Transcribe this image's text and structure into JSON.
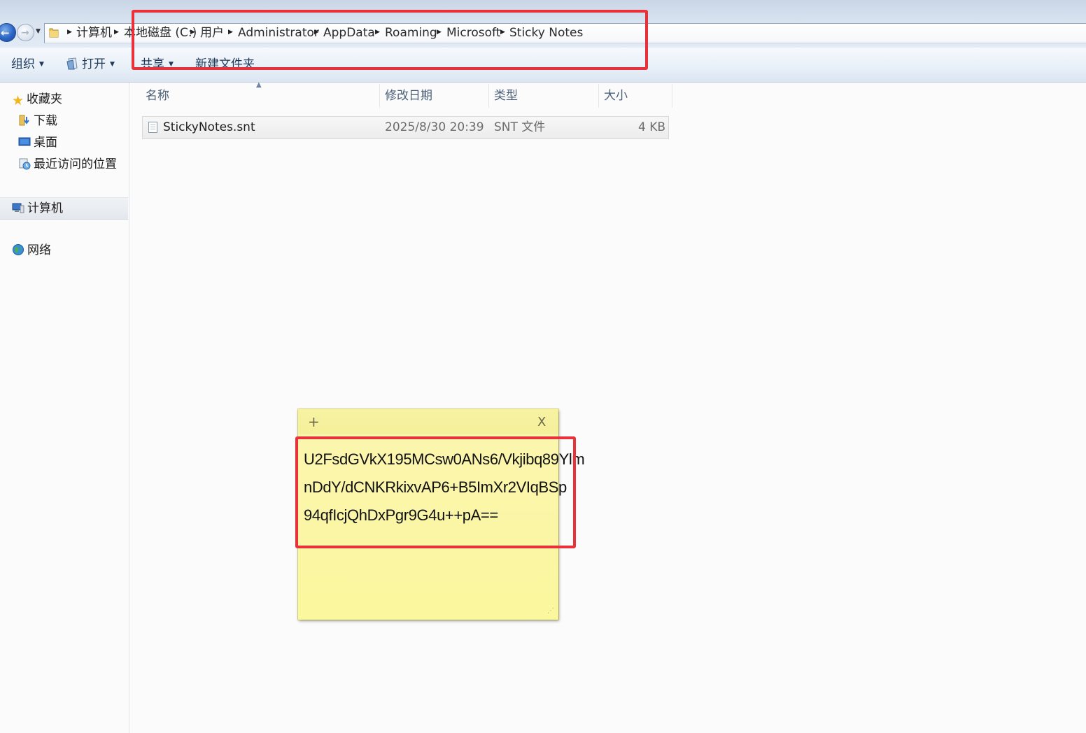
{
  "breadcrumb": [
    "计算机",
    "本地磁盘 (C:)",
    "用户",
    "Administrator",
    "AppData",
    "Roaming",
    "Microsoft",
    "Sticky Notes"
  ],
  "toolbar": {
    "organize": "组织",
    "open": "打开",
    "share": "共享",
    "new_folder": "新建文件夹"
  },
  "sidebar": {
    "favorites": "收藏夹",
    "items": [
      "下载",
      "桌面",
      "最近访问的位置"
    ],
    "computer": "计算机",
    "network": "网络"
  },
  "columns": {
    "name": "名称",
    "modified": "修改日期",
    "type": "类型",
    "size": "大小"
  },
  "file": {
    "name": "StickyNotes.snt",
    "modified": "2025/8/30 20:39",
    "type": "SNT 文件",
    "size": "4 KB"
  },
  "sticky_note": {
    "add": "+",
    "close": "X",
    "lines": [
      "U2FsdGVkX195MCsw0ANs6/Vkjibq89Ylm",
      "nDdY/dCNKRkixvAP6+B5ImXr2VIqBSp",
      "94qfIcjQhDxPgr9G4u++pA=="
    ]
  },
  "colors": {
    "annotation": "#e8313a",
    "sticky_bg": "#fbf6a8",
    "accent": "#1e395b"
  }
}
